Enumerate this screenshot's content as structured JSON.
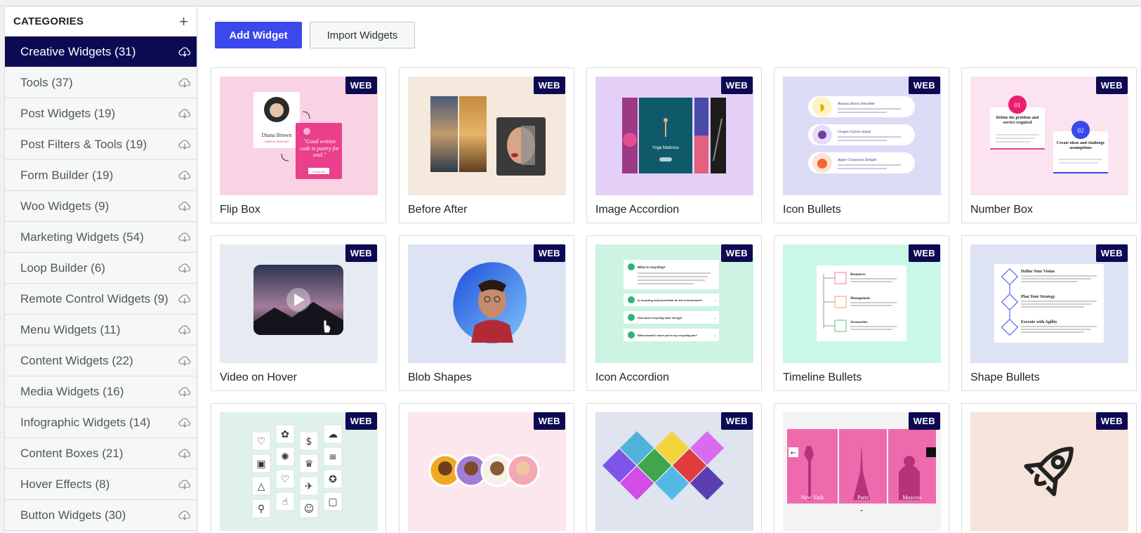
{
  "sidebar": {
    "title": "CATEGORIES",
    "add_symbol": "+",
    "items": [
      {
        "label": "Creative Widgets (31)",
        "active": true
      },
      {
        "label": "Tools (37)"
      },
      {
        "label": "Post Widgets (19)"
      },
      {
        "label": "Post Filters & Tools (19)"
      },
      {
        "label": "Form Builder (19)"
      },
      {
        "label": "Woo Widgets (9)"
      },
      {
        "label": "Marketing Widgets (54)"
      },
      {
        "label": "Loop Builder (6)"
      },
      {
        "label": "Remote Control Widgets (9)"
      },
      {
        "label": "Menu Widgets (11)"
      },
      {
        "label": "Content Widgets (22)"
      },
      {
        "label": "Media Widgets (16)"
      },
      {
        "label": "Infographic Widgets (14)"
      },
      {
        "label": "Content Boxes (21)"
      },
      {
        "label": "Hover Effects (8)"
      },
      {
        "label": "Button Widgets (30)"
      }
    ]
  },
  "toolbar": {
    "add_label": "Add Widget",
    "import_label": "Import Widgets"
  },
  "badge_label": "WEB",
  "colors": {
    "active_bg": "#0c0a52",
    "primary_button": "#3b48ec",
    "badge_bg": "#0c0a52"
  },
  "widgets": [
    {
      "title": "Flip Box",
      "thumb_bg": "#f9d3e3"
    },
    {
      "title": "Before After",
      "thumb_bg": "#f5e8dc"
    },
    {
      "title": "Image Accordion",
      "thumb_bg": "#e4d0f7"
    },
    {
      "title": "Icon Bullets",
      "thumb_bg": "#dcdcf7"
    },
    {
      "title": "Number Box",
      "thumb_bg": "#fbe4ef"
    },
    {
      "title": "Video on Hover",
      "thumb_bg": "#e6eaf2"
    },
    {
      "title": "Blob Shapes",
      "thumb_bg": "#dde3f3"
    },
    {
      "title": "Icon Accordion",
      "thumb_bg": "#cdf3e2"
    },
    {
      "title": "Timeline Bullets",
      "thumb_bg": "#c9f7e8"
    },
    {
      "title": "Shape Bullets",
      "thumb_bg": "#dde3f4"
    },
    {
      "title": "",
      "thumb_bg": "#dff1ea"
    },
    {
      "title": "",
      "thumb_bg": "#fde7ee"
    },
    {
      "title": "",
      "thumb_bg": "#dfe4ef"
    },
    {
      "title": "",
      "thumb_bg": "#f3f3f3"
    },
    {
      "title": "",
      "thumb_bg": "#f5e3dc"
    }
  ],
  "thumb_text": {
    "flip_name": "Diana Brown",
    "flip_role": "GRAPHIC DESIGNER",
    "flip_quote": "\"Good written code is poetry for soul.\"",
    "flip_button": "Follow Me",
    "yoga_title": "Yoga Mattress",
    "bullet_1": "Banana Boost Smoothie",
    "bullet_2": "Grapes Galore Salad",
    "bullet_3": "Apple Cinnamon Delight",
    "num_1": "01",
    "num_1_text": "Define the problem and service required",
    "num_2": "02",
    "num_2_text": "Create ideas and challenge assumptions",
    "acc_1": "What is recycling?",
    "acc_2": "Is recycling truly beneficial for the environment?",
    "acc_3": "How does recycling save energy?",
    "acc_4": "What should I never put in my recycling bin?",
    "tl_1": "Resources",
    "tl_2": "Management",
    "tl_3": "Accessories",
    "sb_1": "Define Your Vision",
    "sb_2": "Plan Your Strategy",
    "sb_3": "Execute with Agility",
    "city_1": "New York",
    "city_2": "Paris",
    "city_3": "Moscow"
  }
}
